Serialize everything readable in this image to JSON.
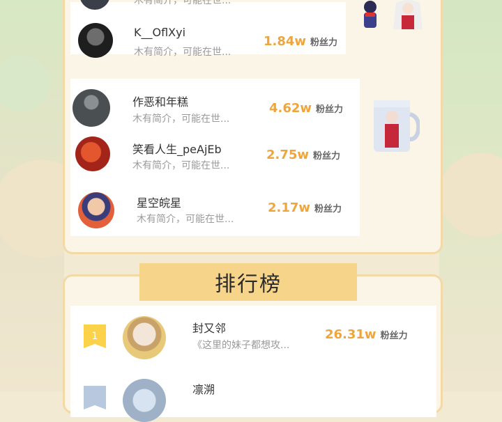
{
  "top_group_1": [
    {
      "name": "",
      "bio": "木有简介，可能在世...",
      "fans": "",
      "unit": ""
    },
    {
      "name": "K__OflXyi",
      "bio": "木有简介，可能在世...",
      "fans": "1.84w",
      "unit": "粉丝力"
    }
  ],
  "top_group_2": [
    {
      "name": "作恶和年糕",
      "bio": "木有简介，可能在世...",
      "fans": "4.62w",
      "unit": "粉丝力"
    },
    {
      "name": "笑看人生_peAjEb",
      "bio": "木有简介，可能在世...",
      "fans": "2.75w",
      "unit": "粉丝力"
    },
    {
      "name": "星空皖星",
      "bio": "木有简介，可能在世...",
      "fans": "2.17w",
      "unit": "粉丝力"
    }
  ],
  "ranking": {
    "title": "排行榜",
    "items": [
      {
        "rank": "1",
        "name": "封又邻",
        "bio": "《这里的妹子都想攻...",
        "fans": "26.31w",
        "unit": "粉丝力"
      },
      {
        "rank": "",
        "name": "凛溯",
        "bio": "",
        "fans": "",
        "unit": ""
      }
    ]
  },
  "colors": {
    "accent": "#f0a53a",
    "banner": "#f6d48a",
    "border": "#f2d9a6",
    "badge": "#fbd24a"
  }
}
